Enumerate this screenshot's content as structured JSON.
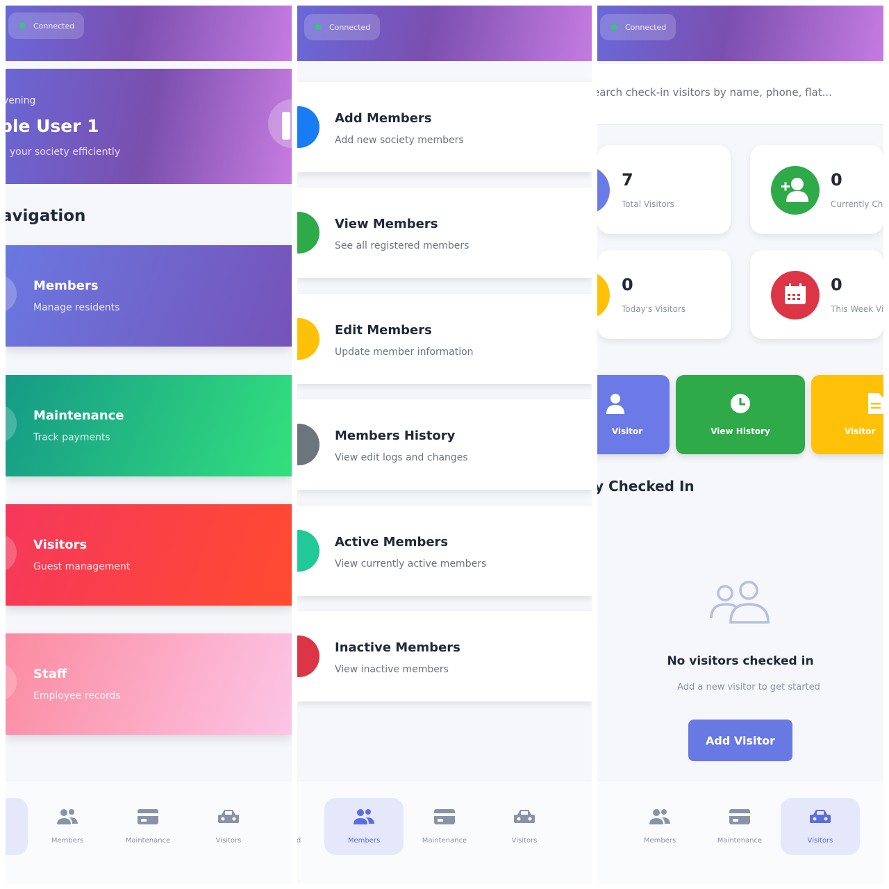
{
  "colors": {
    "accent": "#6979e4",
    "connected_dot": "#2ecc71",
    "members_tile": "#7553b9",
    "maintenance_tile": "#33e07d",
    "visitors_tile": "#f5385c",
    "staff_tile": "#fcc5e6",
    "add_members": "#1a7cf5",
    "view_members": "#2eaa48",
    "edit_members": "#ffc107",
    "members_history": "#6c757d",
    "active_members": "#20c997",
    "inactive_members": "#dc3545",
    "stat_total": "#6b7ae6",
    "stat_current": "#2eaa48",
    "stat_today": "#ffc107",
    "stat_week": "#dc3545"
  },
  "status": {
    "connected": "Connected"
  },
  "dashboard": {
    "greeting": "vening",
    "user_name": "ple User 1",
    "tagline": "your society efficiently",
    "nav_title": "avigation",
    "tiles": [
      {
        "title": "Members",
        "subtitle": "Manage residents"
      },
      {
        "title": "Maintenance",
        "subtitle": "Track payments"
      },
      {
        "title": "Visitors",
        "subtitle": "Guest management"
      },
      {
        "title": "Staff",
        "subtitle": "Employee records"
      }
    ]
  },
  "members_menu": {
    "items": [
      {
        "title": "Add Members",
        "subtitle": "Add new society members",
        "icon": "user-plus-icon"
      },
      {
        "title": "View Members",
        "subtitle": "See all registered members",
        "icon": "users-icon"
      },
      {
        "title": "Edit Members",
        "subtitle": "Update member information",
        "icon": "edit-icon"
      },
      {
        "title": "Members History",
        "subtitle": "View edit logs and changes",
        "icon": "history-icon"
      },
      {
        "title": "Active Members",
        "subtitle": "View currently active members",
        "icon": "check-icon"
      },
      {
        "title": "Inactive Members",
        "subtitle": "View inactive members",
        "icon": "ban-icon"
      }
    ]
  },
  "visitors": {
    "search_placeholder": "earch check-in visitors by name, phone, flat...",
    "stats": [
      {
        "value": "7",
        "label": "Total Visitors",
        "icon": "users-icon"
      },
      {
        "value": "0",
        "label": "Currently Che",
        "icon": "user-check-icon"
      },
      {
        "value": "0",
        "label": "Today's Visitors",
        "icon": "clock-icon"
      },
      {
        "value": "0",
        "label": "This Week Vis",
        "icon": "calendar-icon"
      }
    ],
    "quick_actions": [
      {
        "label": "Visitor",
        "icon": "user-plus-icon"
      },
      {
        "label": "View History",
        "icon": "clock-icon"
      },
      {
        "label": "Visitor",
        "icon": "document-icon"
      }
    ],
    "section_title": "y Checked In",
    "empty_title": "No visitors checked in",
    "empty_subtitle": "Add a new visitor to get started",
    "add_button": "Add Visitor"
  },
  "bottom_nav": {
    "partial_label": "d",
    "members": "Members",
    "maintenance": "Maintenance",
    "visitors": "Visitors"
  }
}
